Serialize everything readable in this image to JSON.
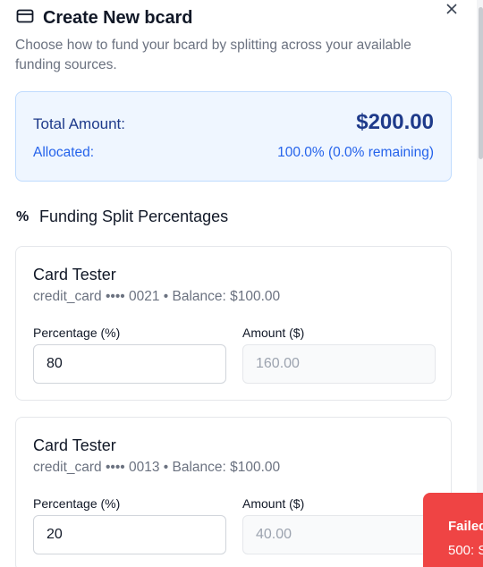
{
  "dialog": {
    "title": "Create New bcard",
    "title_icon": "credit-card-icon",
    "close_icon": "close-icon",
    "subtitle": "Choose how to fund your bcard by splitting across your available funding sources."
  },
  "summary": {
    "total_label": "Total Amount:",
    "total_value": "$200.00",
    "allocated_label": "Allocated:",
    "allocated_value": "100.0% (0.0% remaining)"
  },
  "section": {
    "icon": "%",
    "title": "Funding Split Percentages"
  },
  "sources": [
    {
      "name": "Card Tester",
      "meta": "credit_card •••• 0021 • Balance: $100.00",
      "percentage_label": "Percentage (%)",
      "percentage_value": "80",
      "amount_label": "Amount ($)",
      "amount_value": "160.00"
    },
    {
      "name": "Card Tester",
      "meta": "credit_card •••• 0013 • Balance: $100.00",
      "percentage_label": "Percentage (%)",
      "percentage_value": "20",
      "amount_label": "Amount ($)",
      "amount_value": "40.00"
    }
  ],
  "toast": {
    "title": "Failed",
    "message": "500: S"
  },
  "colors": {
    "accent_blue": "#1e3a8a",
    "link_blue": "#2563eb",
    "summary_bg": "#eff6ff",
    "error_red": "#ef4444"
  }
}
